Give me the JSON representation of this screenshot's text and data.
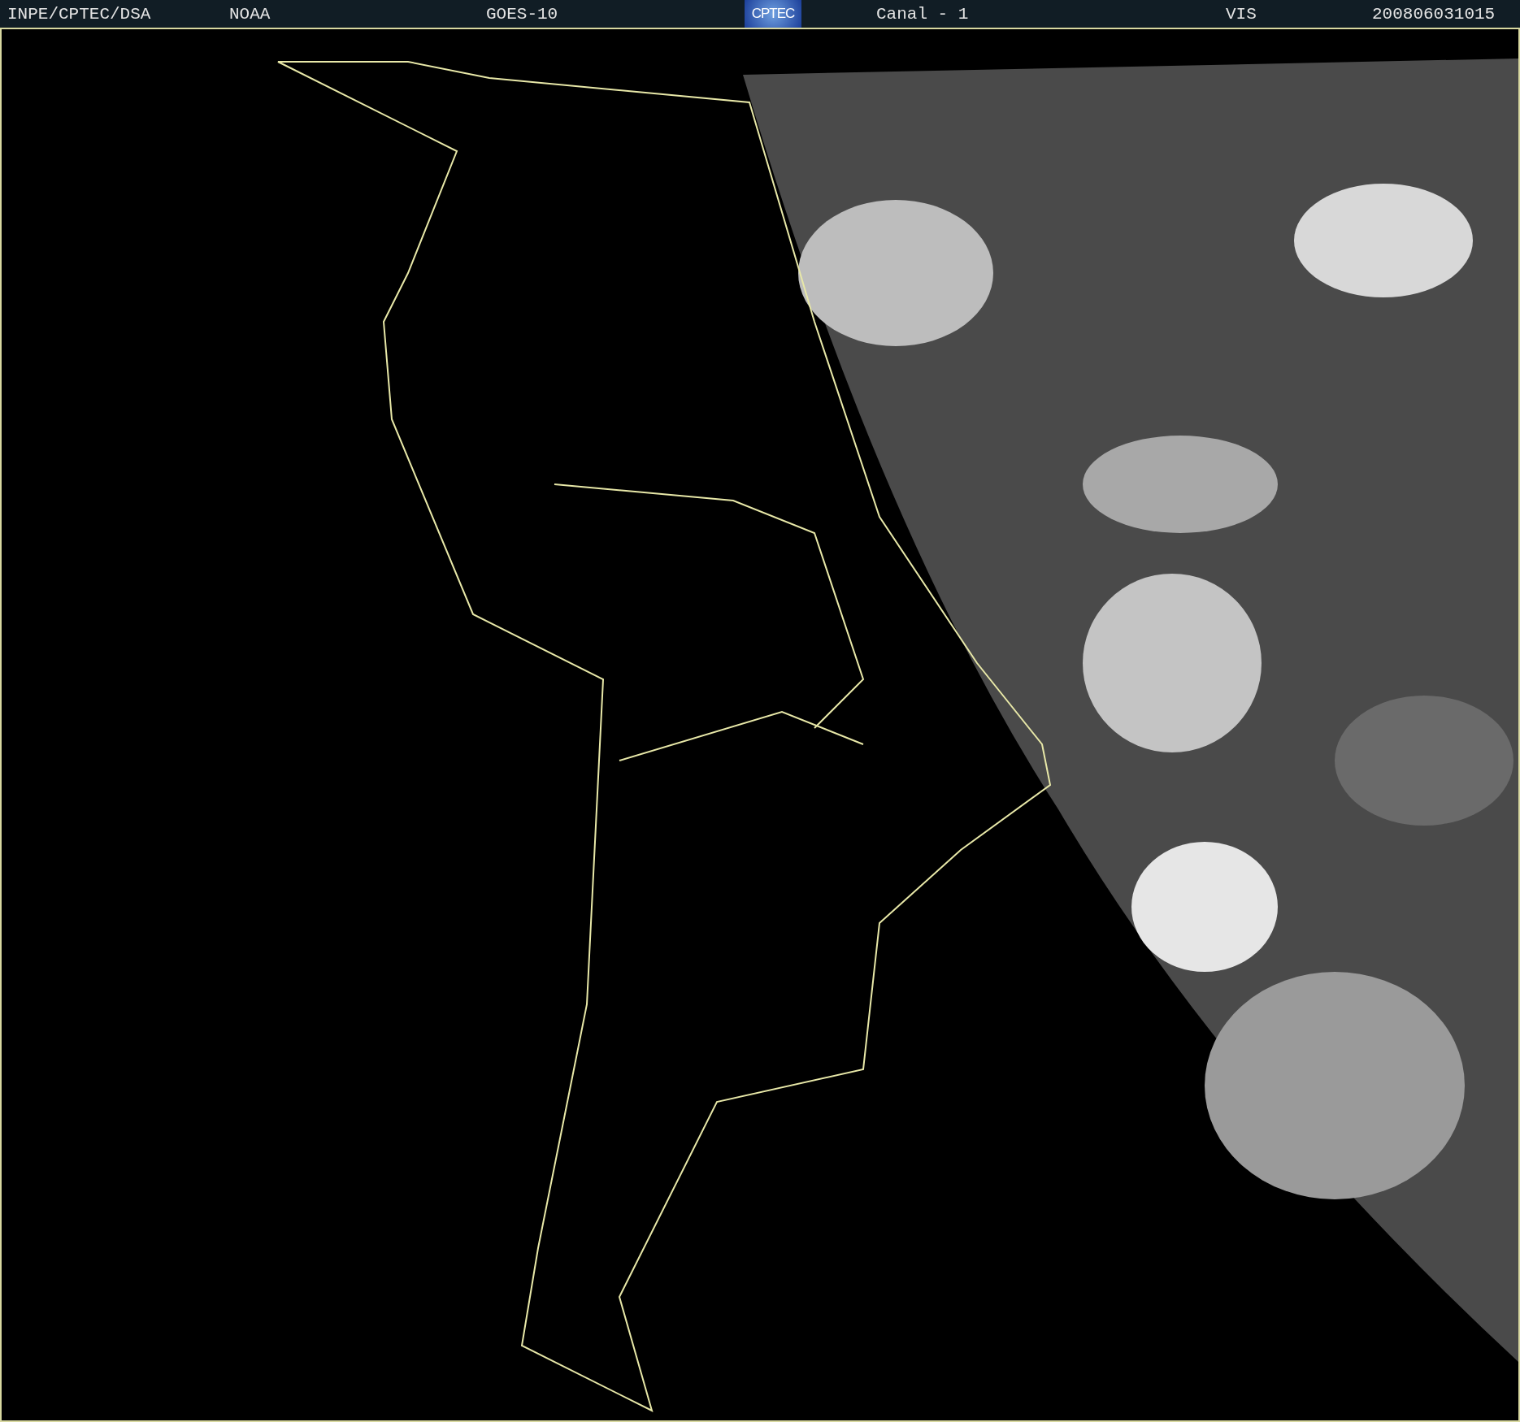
{
  "header": {
    "source": "INPE/CPTEC/DSA",
    "agency": "NOAA",
    "satellite": "GOES-10",
    "logo": "CPTEC",
    "channel": "Canal - 1",
    "band": "VIS",
    "timestamp": "200806031015"
  }
}
